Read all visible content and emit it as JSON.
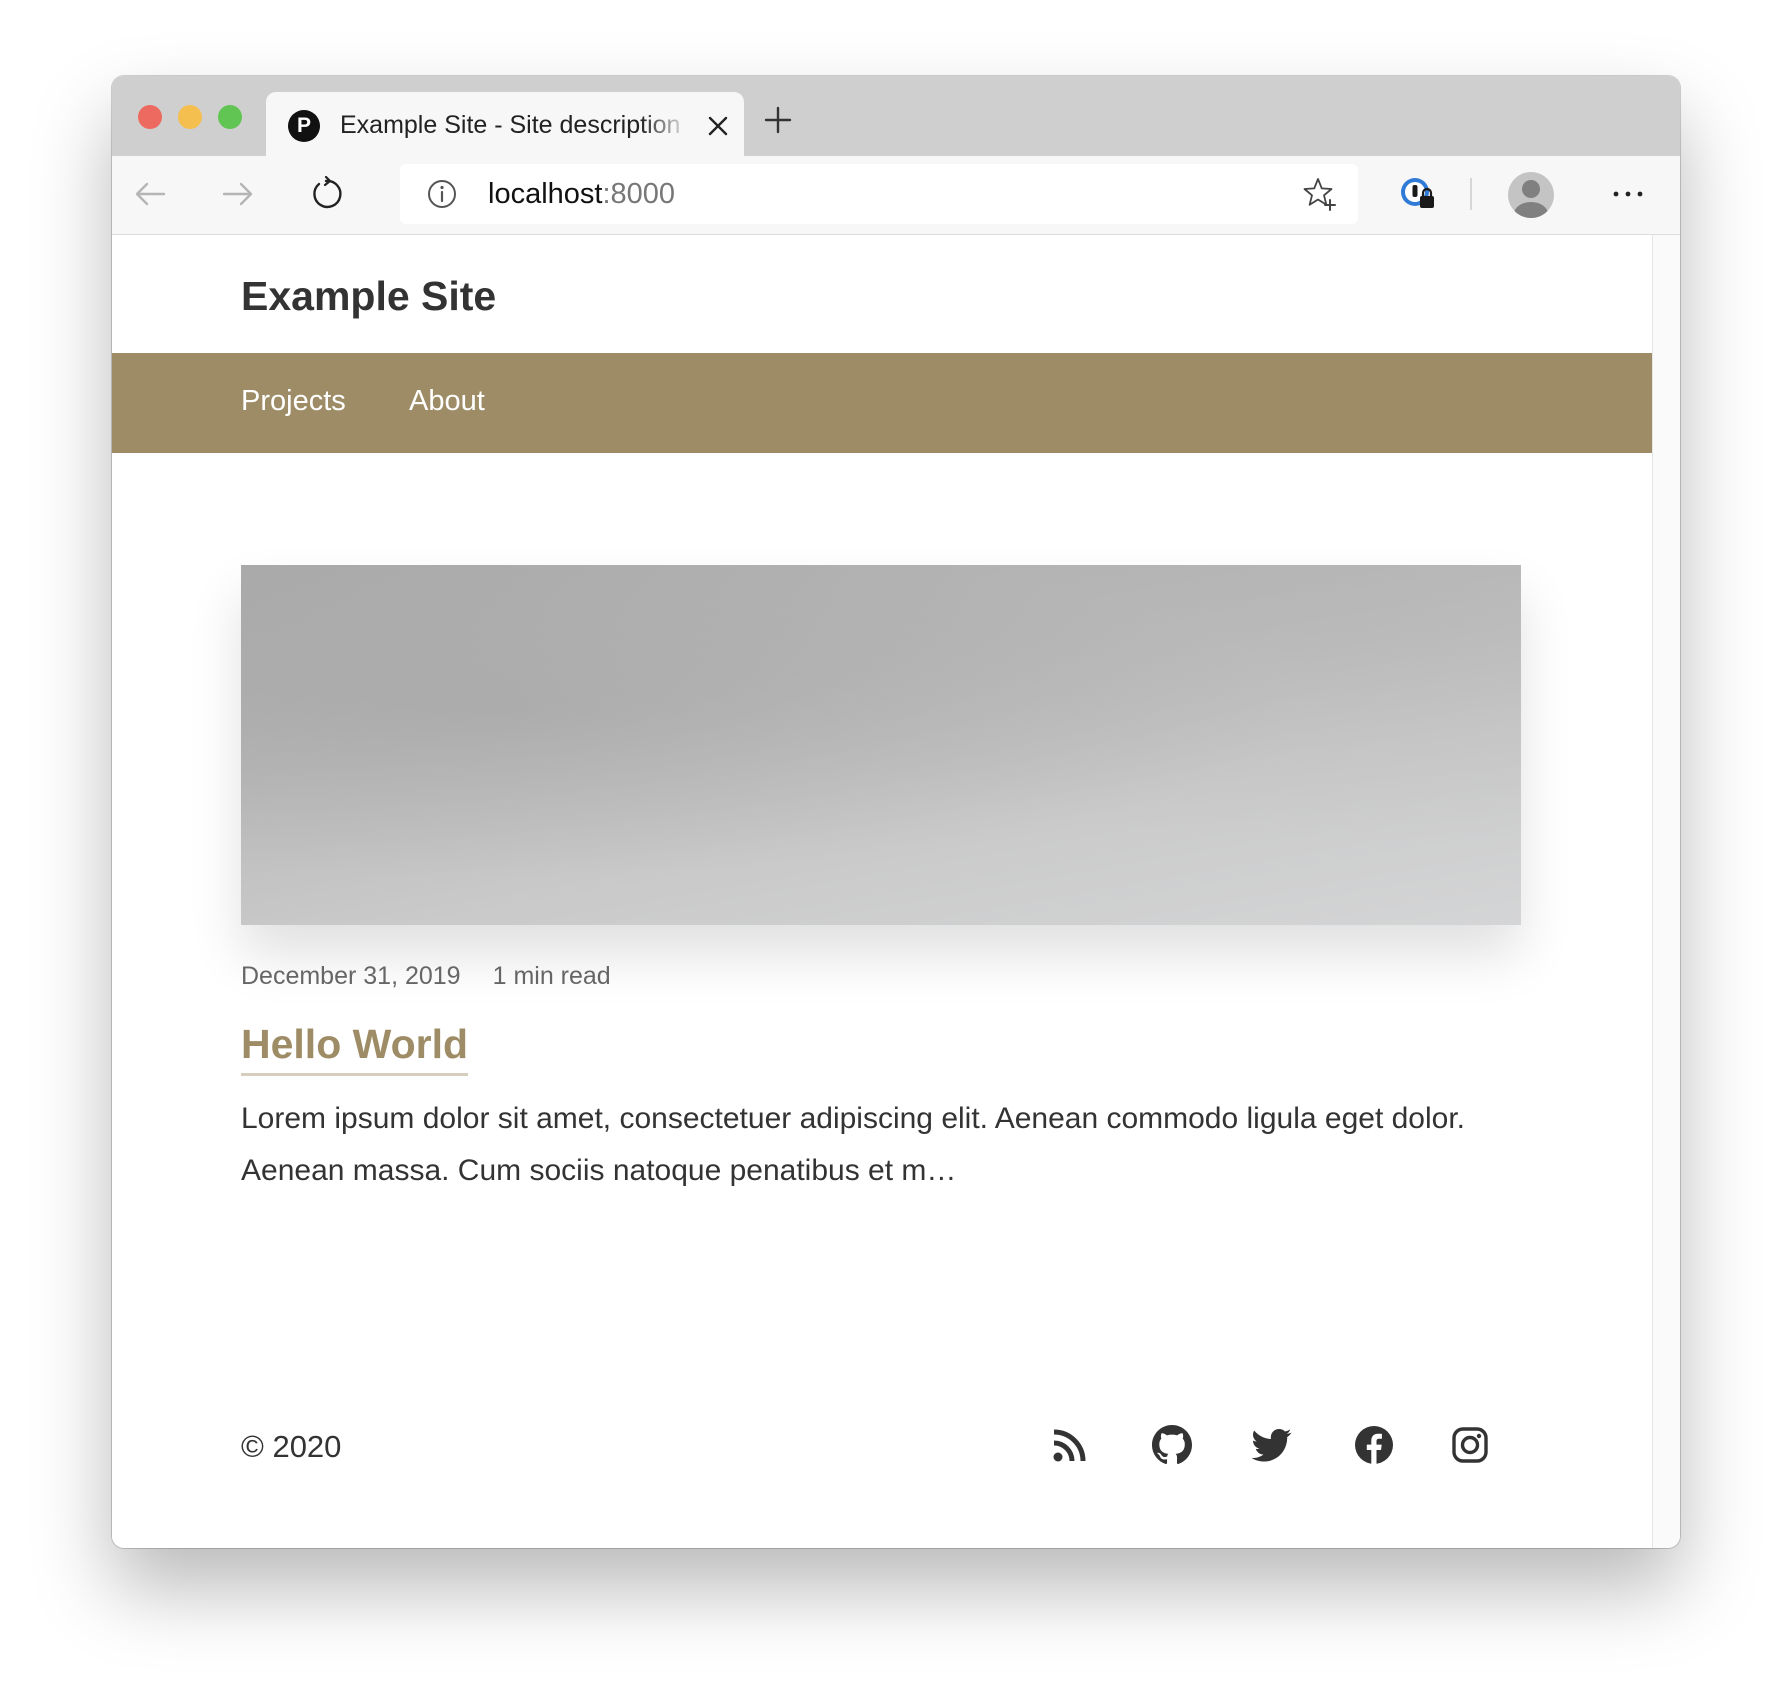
{
  "browser": {
    "tab_title": "Example Site - Site description",
    "tab_favicon_letter": "P",
    "address_host": "localhost",
    "address_port": ":8000",
    "icons": [
      "back-icon",
      "forward-icon",
      "reload-icon",
      "info-icon",
      "favorite-star-icon",
      "password-manager-icon",
      "profile-avatar",
      "more-icon",
      "close-icon",
      "new-tab-icon"
    ]
  },
  "site": {
    "title": "Example Site",
    "nav": [
      "Projects",
      "About"
    ],
    "accent_color": "#9e8c66"
  },
  "post": {
    "date": "December 31, 2019",
    "read_time": "1 min read",
    "title": "Hello World",
    "excerpt": "Lorem ipsum dolor sit amet, consectetuer adipiscing elit. Aenean commodo ligula eget dolor. Aenean massa. Cum sociis natoque penatibus et m…"
  },
  "footer": {
    "copyright": "© 2020",
    "social_icons": [
      "rss-icon",
      "github-icon",
      "twitter-icon",
      "facebook-icon",
      "instagram-icon"
    ]
  }
}
